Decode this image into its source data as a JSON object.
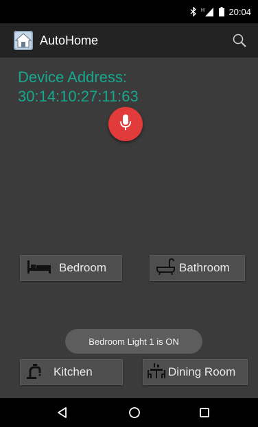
{
  "status_bar": {
    "time": "20:04",
    "icons": [
      "bluetooth-icon",
      "signal-icon",
      "battery-icon"
    ]
  },
  "action_bar": {
    "title": "AutoHome",
    "icons": [
      "app-home-icon",
      "search-icon"
    ]
  },
  "device": {
    "label": "Device Address:",
    "address": "30:14:10:27:11:63"
  },
  "mic": {
    "icon": "microphone-icon",
    "color": "#e23b3b"
  },
  "rooms": [
    {
      "label": "Bedroom",
      "icon": "bed-icon"
    },
    {
      "label": "Bathroom",
      "icon": "bathtub-icon"
    },
    {
      "label": "Kitchen",
      "icon": "faucet-icon"
    },
    {
      "label": "Dining Room",
      "icon": "dining-table-icon"
    }
  ],
  "toast": {
    "text": "Bedroom Light 1 is ON"
  },
  "nav_bar": {
    "icons": [
      "back-icon",
      "home-icon",
      "recents-icon"
    ]
  },
  "colors": {
    "accent_text": "#17a88f",
    "background": "#3b3b3b",
    "action_bar": "#232323"
  }
}
